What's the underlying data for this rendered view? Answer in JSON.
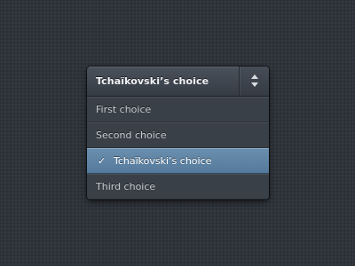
{
  "select": {
    "value": "Tchaïkovski’s choice",
    "arrows_icon": "up-down-arrows-icon",
    "options": [
      {
        "label": "First choice",
        "selected": false
      },
      {
        "label": "Second choice",
        "selected": false
      },
      {
        "label": "Tchaïkovski’s choice",
        "selected": true,
        "check": "✓"
      },
      {
        "label": "Third choice",
        "selected": false
      }
    ]
  },
  "colors": {
    "background": "#2f343b",
    "selected_option": "#6a8eae",
    "header": "#4a515b"
  }
}
